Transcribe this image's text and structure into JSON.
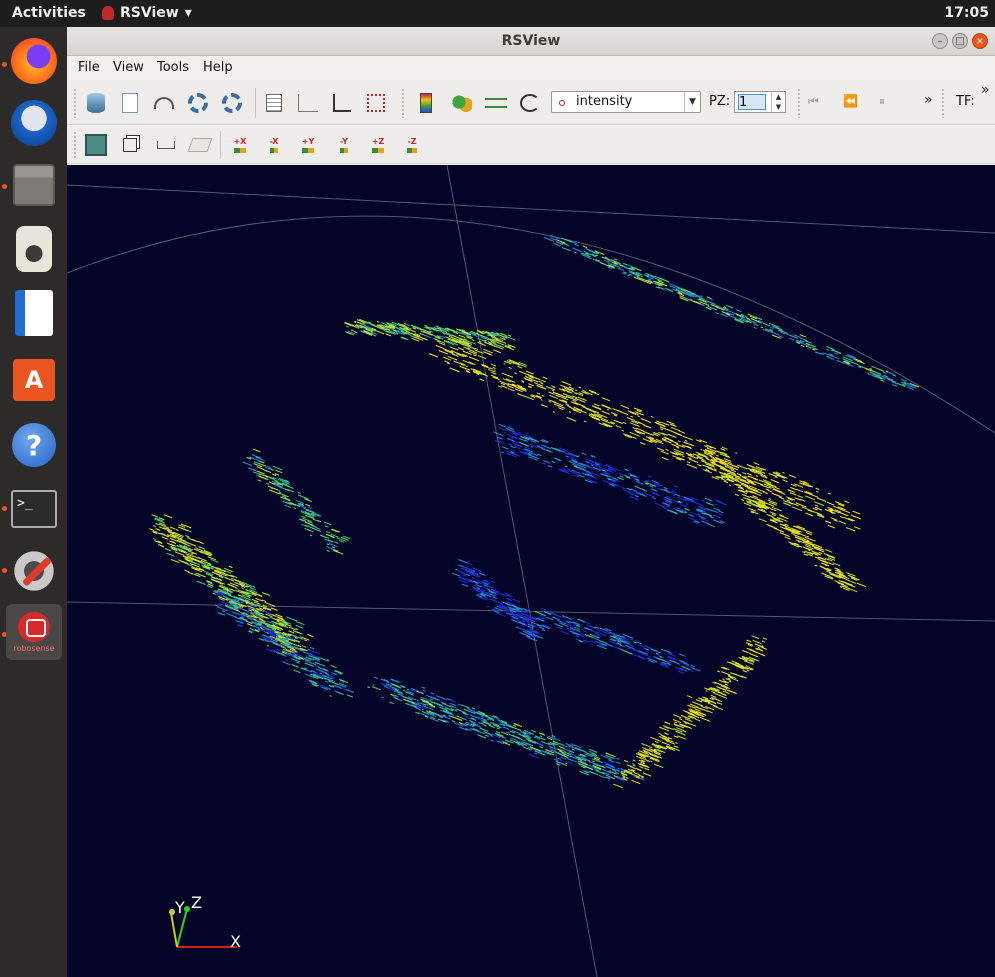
{
  "topbar": {
    "activities_label": "Activities",
    "app_name": "RSView",
    "clock": "17:05"
  },
  "dock": {
    "items": [
      {
        "name": "Firefox",
        "icon": "firefox-icon",
        "running": true
      },
      {
        "name": "Thunderbird",
        "icon": "thunderbird-icon",
        "running": false
      },
      {
        "name": "Files",
        "icon": "files-icon",
        "running": true
      },
      {
        "name": "Rhythmbox",
        "icon": "rhythmbox-icon",
        "running": false
      },
      {
        "name": "LibreOffice Writer",
        "icon": "writer-icon",
        "running": false
      },
      {
        "name": "Ubuntu Software",
        "icon": "software-store-icon",
        "running": false
      },
      {
        "name": "Help",
        "icon": "help-icon",
        "running": false
      },
      {
        "name": "Terminal",
        "icon": "terminal-icon",
        "running": true
      },
      {
        "name": "System Tools",
        "icon": "system-tools-icon",
        "running": true
      },
      {
        "name": "robosense",
        "icon": "robosense-icon",
        "running": true,
        "label": "robosense"
      }
    ]
  },
  "window": {
    "title": "RSView",
    "controls": {
      "minimize": "–",
      "maximize": "□",
      "close": "×"
    }
  },
  "menubar": {
    "file": "File",
    "view": "View",
    "tools": "Tools",
    "help": "Help"
  },
  "toolbar": {
    "color_by": "intensity",
    "pz_label": "PZ:",
    "pz_value": "1",
    "overflow": "»",
    "tf_label": "TF:",
    "playback": {
      "first": "⏮",
      "back": "⏪",
      "pause": "⏸"
    },
    "axis_buttons": [
      "+X",
      "-X",
      "+Y",
      "-Y",
      "+Z",
      "-Z"
    ]
  },
  "viewport": {
    "background": "#040428",
    "color_scale": [
      "#1a2fe0",
      "#1f8fd8",
      "#39d07a",
      "#b8e22a",
      "#f7e01c"
    ],
    "orientation_axes": {
      "x": "X",
      "y": "Y",
      "z": "Z"
    }
  }
}
